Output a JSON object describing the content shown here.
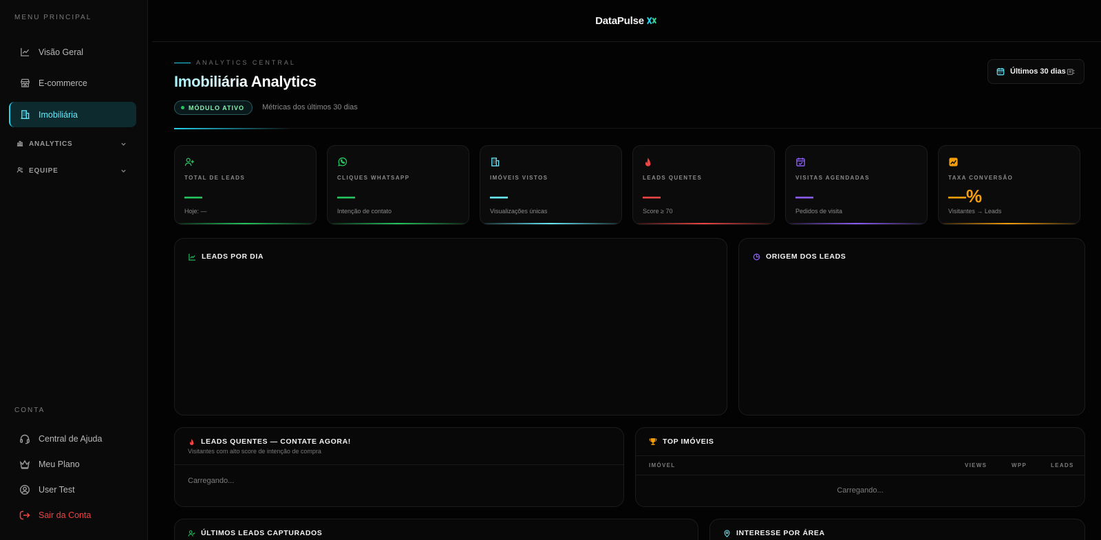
{
  "sidebar": {
    "menu_label": "MENU PRINCIPAL",
    "items": [
      {
        "label": "Visão Geral",
        "icon": "chart-line-icon"
      },
      {
        "label": "E-commerce",
        "icon": "store-icon"
      },
      {
        "label": "Imobiliária",
        "icon": "building-icon",
        "active": true
      }
    ],
    "groups": [
      {
        "label": "ANALYTICS",
        "icon": "analytics-icon"
      },
      {
        "label": "EQUIPE",
        "icon": "team-icon"
      }
    ],
    "account_label": "CONTA",
    "account_items": [
      {
        "label": "Central de Ajuda",
        "icon": "headset-icon"
      },
      {
        "label": "Meu Plano",
        "icon": "crown-icon"
      },
      {
        "label": "User Test",
        "icon": "user-circle-icon"
      },
      {
        "label": "Sair da Conta",
        "icon": "logout-icon"
      }
    ]
  },
  "header": {
    "brand": "DataPulse",
    "eyebrow": "ANALYTICS CENTRAL",
    "title": "Imobiliária Analytics",
    "badge": "MÓDULO ATIVO",
    "subtitle": "Métricas dos últimos 30 dias",
    "date_range": "Últimos 30 dias"
  },
  "cards": [
    {
      "label": "TOTAL DE LEADS",
      "value": "—",
      "sub": "Hoje: —",
      "color": "#22c55e",
      "icon": "user-plus-icon"
    },
    {
      "label": "CLIQUES WHATSAPP",
      "value": "—",
      "sub": "Intenção de contato",
      "color": "#22c55e",
      "icon": "whatsapp-icon"
    },
    {
      "label": "IMÓVEIS VISTOS",
      "value": "—",
      "sub": "Visualizações únicas",
      "color": "#67e8f9",
      "icon": "building-icon"
    },
    {
      "label": "LEADS QUENTES",
      "value": "—",
      "sub": "Score ≥ 70",
      "color": "#ef4444",
      "icon": "fire-icon"
    },
    {
      "label": "VISITAS AGENDADAS",
      "value": "—",
      "sub": "Pedidos de visita",
      "color": "#8b5cf6",
      "icon": "calendar-check-icon"
    },
    {
      "label": "TAXA CONVERSÃO",
      "value": "—%",
      "sub": "Visitantes → Leads",
      "color": "#f59e0b",
      "icon": "trend-icon"
    }
  ],
  "panels": {
    "leads_por_dia": "LEADS POR DIA",
    "origem": "ORIGEM DOS LEADS",
    "hot_title": "LEADS QUENTES — CONTATE AGORA!",
    "hot_sub": "Visitantes com alto score de intenção de compra",
    "hot_loading": "Carregando...",
    "top_title": "TOP IMÓVEIS",
    "top_columns": [
      "IMÓVEL",
      "VIEWS",
      "WPP",
      "LEADS"
    ],
    "top_loading": "Carregando...",
    "ultimos_title": "ÚLTIMOS LEADS CAPTURADOS",
    "area_title": "INTERESSE POR ÁREA"
  }
}
